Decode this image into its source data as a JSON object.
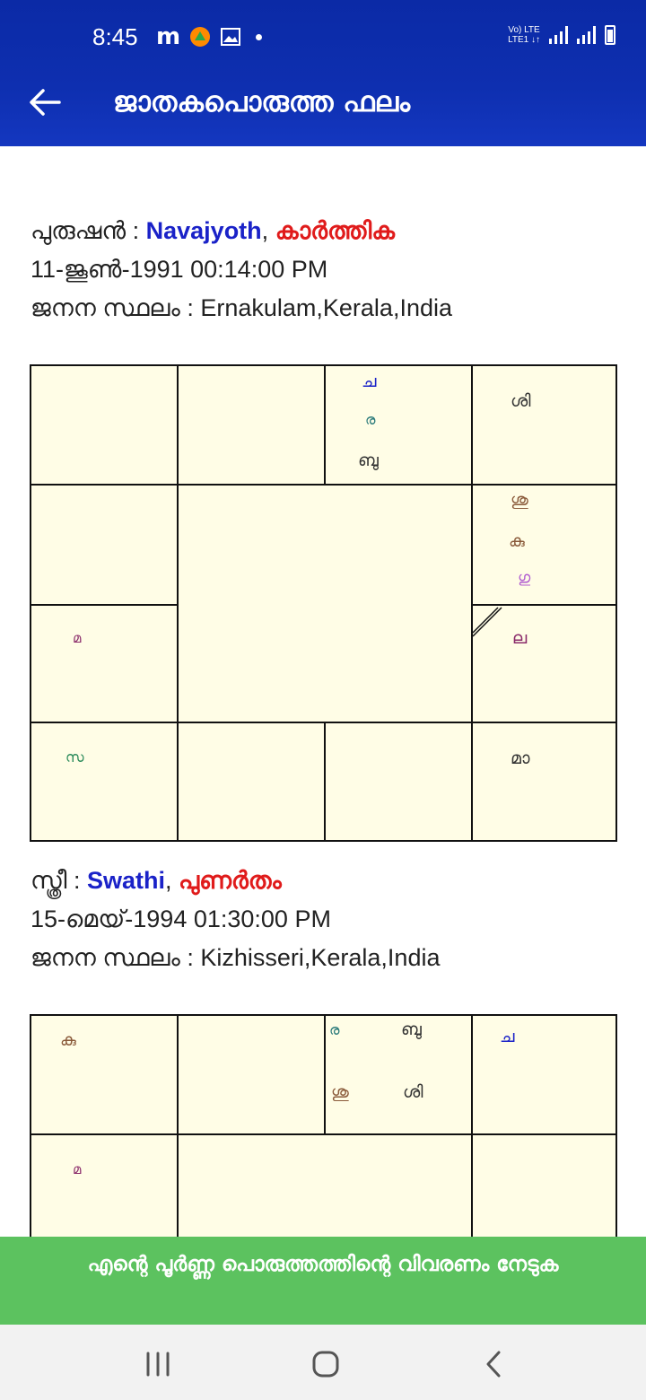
{
  "status_bar": {
    "time": "8:45",
    "icons": [
      "m-icon",
      "app-icon",
      "gallery-icon",
      "dot-icon"
    ],
    "network_label_top": "Vo) LTE",
    "network_label_bottom": "LTE1 ↓↑"
  },
  "app_bar": {
    "title": "ജാതകപൊരുത്ത ഫലം"
  },
  "male": {
    "label": "പുരുഷൻ : ",
    "name": "Navajyoth",
    "separator": ", ",
    "star": "കാർത്തിക",
    "datetime": "11-ജൂൺ-1991 00:14:00 PM",
    "birthplace_label": "ജനന സ്ഥലം : ",
    "birthplace": "Ernakulam,Kerala,India"
  },
  "male_chart": {
    "cells": [
      {
        "text": "ച",
        "color": "#1a22c8"
      },
      {
        "text": "ര",
        "color": "#2a7a7a"
      },
      {
        "text": "ബു",
        "color": "#333333"
      },
      {
        "text": "ശി",
        "color": "#333333"
      },
      {
        "text": "ശു",
        "color": "#8a5a3a"
      },
      {
        "text": "കു",
        "color": "#8a5a3a"
      },
      {
        "text": "ഗു",
        "color": "#b05ad0"
      },
      {
        "text": "മ",
        "color": "#8a2a6a"
      },
      {
        "text": "ല",
        "color": "#8a2a6a"
      },
      {
        "text": "സ",
        "color": "#2a8a5a"
      },
      {
        "text": "മാ",
        "color": "#333333"
      }
    ]
  },
  "female": {
    "label": "സ്ത്രീ : ",
    "name": "Swathi",
    "separator": ", ",
    "star": "പുണർതം",
    "datetime": "15-മെയ്-1994 01:30:00 PM",
    "birthplace_label": "ജനന സ്ഥലം : ",
    "birthplace": "Kizhisseri,Kerala,India"
  },
  "female_chart": {
    "cells": [
      {
        "text": "കു",
        "color": "#8a5a3a"
      },
      {
        "text": "ര",
        "color": "#2a7a7a"
      },
      {
        "text": "ബു",
        "color": "#333333"
      },
      {
        "text": "ശു",
        "color": "#8a5a3a"
      },
      {
        "text": "ശി",
        "color": "#333333"
      },
      {
        "text": "ച",
        "color": "#1a22c8"
      },
      {
        "text": "മ",
        "color": "#8a2a6a"
      }
    ]
  },
  "cta": {
    "label": "എന്റെ പൂർണ്ണ പൊരുത്തത്തിന്റെ വിവരണം നേടുക"
  },
  "navbar": {
    "buttons": [
      "recent-apps-icon",
      "home-icon",
      "back-icon"
    ]
  },
  "colors": {
    "app_bar": "#0e2fb0",
    "chart_bg": "#fffde6",
    "name": "#1a22c8",
    "star": "#e01b1b",
    "cta": "#5cc25f"
  }
}
